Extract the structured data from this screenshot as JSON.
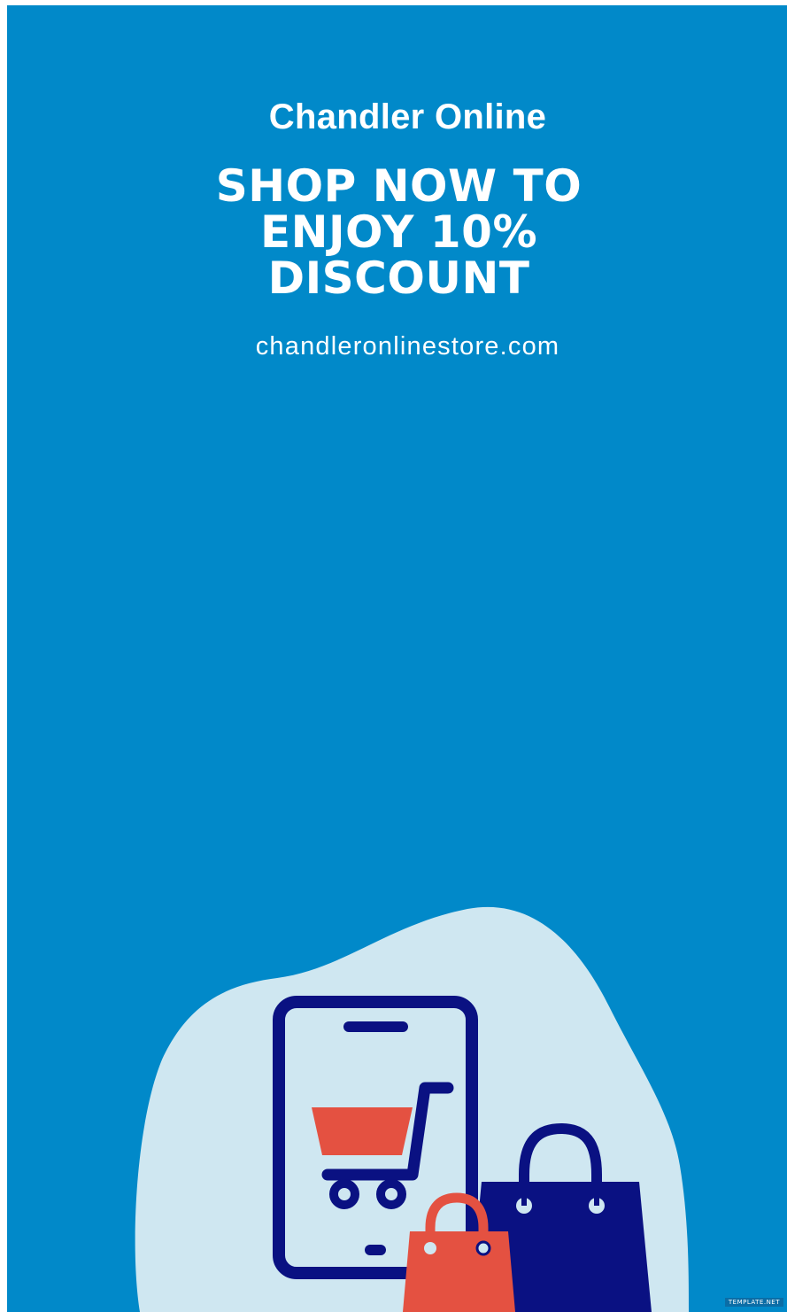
{
  "poster": {
    "brand_name": "Chandler Online",
    "headline_lines": [
      "SHOP NOW TO",
      "ENJOY 10%",
      "DISCOUNT"
    ],
    "website": "chandleronlinestore.com",
    "watermark": "TEMPLATE.NET"
  },
  "colors": {
    "background": "#0189c9",
    "blob": "#cfe7f1",
    "navy": "#0a1182",
    "red": "#e45141",
    "text": "#ffffff"
  },
  "illustration": {
    "icons": [
      "smartphone-icon",
      "shopping-cart-icon",
      "shopping-bag-icon"
    ]
  }
}
